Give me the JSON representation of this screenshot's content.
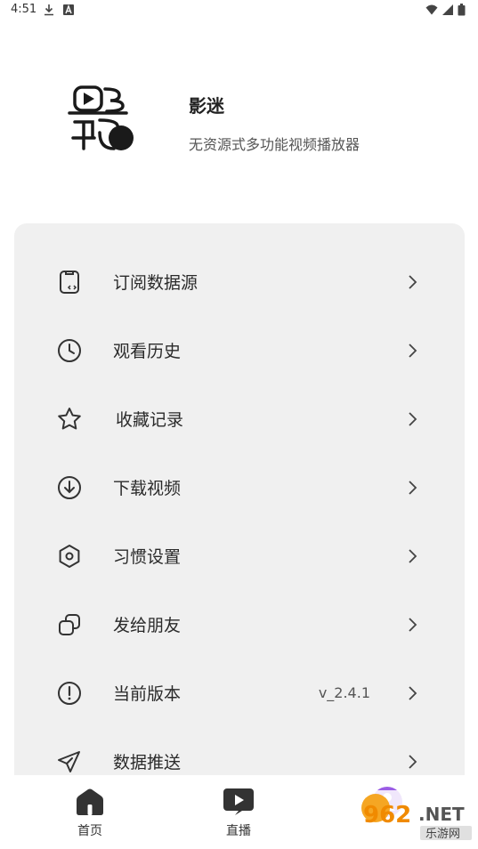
{
  "status_bar": {
    "time": "4:51",
    "icons": [
      "download-icon",
      "a-box-icon",
      "wifi-icon",
      "signal-icon",
      "battery-icon"
    ]
  },
  "app": {
    "name": "影迷",
    "description": "无资源式多功能视频播放器",
    "logo": "yingmi-logo"
  },
  "menu": [
    {
      "label": "订阅数据源",
      "icon": "subscribe-source-icon"
    },
    {
      "label": "观看历史",
      "icon": "clock-icon"
    },
    {
      "label": "收藏记录",
      "icon": "star-icon"
    },
    {
      "label": "下载视频",
      "icon": "download-circle-icon"
    },
    {
      "label": "习惯设置",
      "icon": "settings-hexagon-icon"
    },
    {
      "label": "发给朋友",
      "icon": "share-squares-icon"
    },
    {
      "label": "当前版本",
      "icon": "info-circle-icon",
      "value": "v_2.4.1"
    },
    {
      "label": "数据推送",
      "icon": "send-icon"
    }
  ],
  "bottom_nav": [
    {
      "label": "首页",
      "icon": "home-icon"
    },
    {
      "label": "直播",
      "icon": "live-play-icon"
    },
    {
      "label": "",
      "icon": "profile-icon"
    }
  ],
  "watermark": {
    "main": "962.NET",
    "sub": "乐游网"
  },
  "colors": {
    "card_bg": "#f0f0f0",
    "icon": "#333333",
    "profile_accent": "#9b5de5"
  }
}
